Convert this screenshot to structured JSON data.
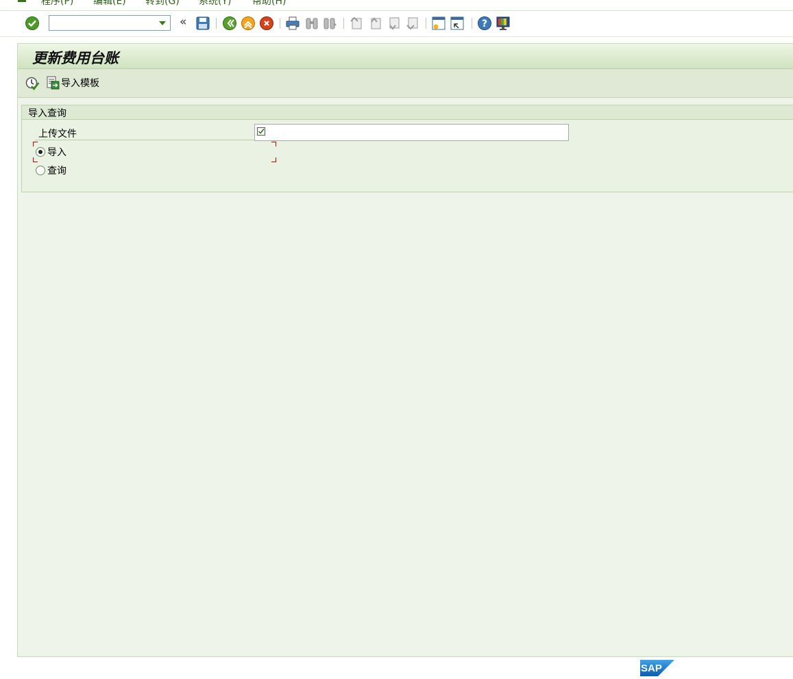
{
  "menubar": {
    "items": [
      "程序(P)",
      "编辑(E)",
      "转到(G)",
      "系统(Y)",
      "帮助(H)"
    ]
  },
  "systoolbar": {
    "command_field_value": "",
    "icons": [
      "enter-icon",
      "save-icon",
      "back-icon",
      "exit-icon",
      "cancel-icon",
      "print-icon",
      "find-icon",
      "find-next-icon",
      "first-page-icon",
      "previous-page-icon",
      "next-page-icon",
      "last-page-icon",
      "create-session-icon",
      "shortcut-icon",
      "help-icon",
      "customize-layout-icon"
    ]
  },
  "title": {
    "text": "更新费用台账"
  },
  "app_toolbar": {
    "import_template_label": "导入模板"
  },
  "groupbox": {
    "title": "导入查询",
    "upload_file_label": "上传文件",
    "upload_file_value": "",
    "options": [
      {
        "label": "导入",
        "selected": true
      },
      {
        "label": "查询",
        "selected": false
      }
    ]
  },
  "footer": {
    "logo_text": "SAP"
  },
  "colors": {
    "accent_green": "#3a7a1b",
    "background": "#eef4ea",
    "focus_red": "#c00000"
  }
}
